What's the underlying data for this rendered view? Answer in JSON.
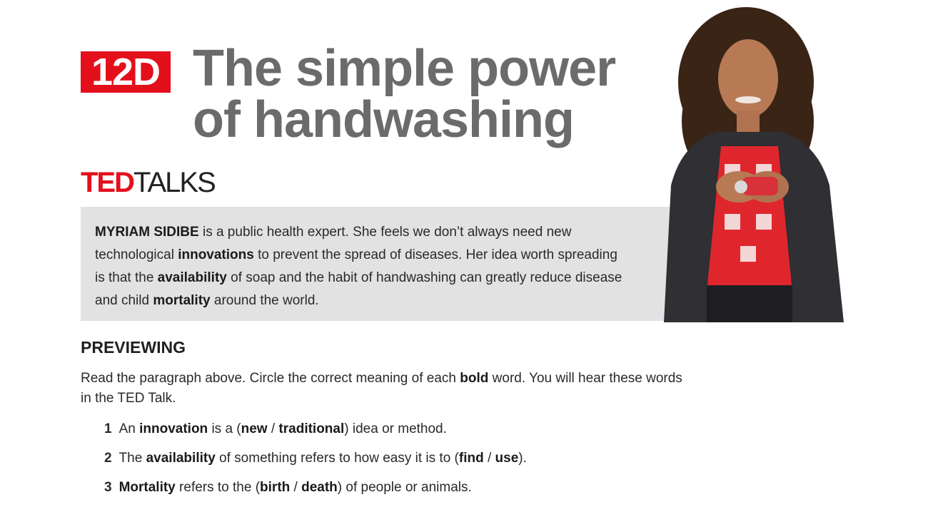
{
  "header": {
    "unit": "12D",
    "title_line1": "The simple power",
    "title_line2": "of handwashing"
  },
  "brand": {
    "ted": "TED",
    "talks": "TALKS"
  },
  "intro": {
    "speaker_name": "MYRIAM SIDIBE",
    "t1": " is a public health expert. She feels we don’t always need new technological ",
    "w1": "innovations",
    "t2": " to prevent the spread of diseases. Her idea worth spreading is that the ",
    "w2": "availability",
    "t3": " of soap and the habit of handwashing can greatly reduce disease and child ",
    "w3": "mortality",
    "t4": " around the world."
  },
  "previewing": {
    "heading": "PREVIEWING",
    "inst1": "Read the paragraph above. Circle the correct meaning of each ",
    "inst_bold": "bold",
    "inst2": " word. You will hear these words in the TED Talk.",
    "items": [
      {
        "num": "1",
        "p1": "An ",
        "b1": "innovation",
        "p2": " is a (",
        "b2": "new",
        "p3": " / ",
        "b3": "traditional",
        "p4": ") idea or method."
      },
      {
        "num": "2",
        "p1": "The ",
        "b1": "availability",
        "p2": " of something refers to how easy it is to (",
        "b2": "find",
        "p3": " / ",
        "b3": "use",
        "p4": ")."
      },
      {
        "num": "3",
        "p1": "",
        "b1": "Mortality",
        "p2": " refers to the (",
        "b2": "birth",
        "p3": " / ",
        "b3": "death",
        "p4": ") of people or animals."
      }
    ]
  },
  "colors": {
    "accent": "#e3101b",
    "title_gray": "#6b6b6b",
    "box_gray": "#e2e2e2"
  }
}
